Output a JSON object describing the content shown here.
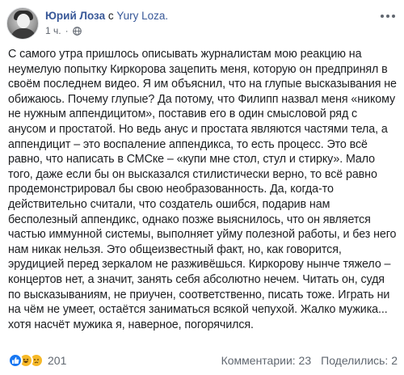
{
  "header": {
    "author_name": "Юрий Лоза",
    "with_word": "с",
    "page_name": "Yury Loza.",
    "time": "1 ч.",
    "dot": "·"
  },
  "post": {
    "text": "С самого утра пришлось описывать журналистам мою реакцию на неумелую попытку Киркорова зацепить меня, которую он предпринял в своём последнем видео. Я им объяснил, что на глупые высказывания не обижаюсь. Почему глупые? Да потому, что Филипп назвал меня «никому не нужным аппендицитом», поставив его в один смысловой ряд с анусом и простатой. Но ведь анус и простата являются частями тела, а аппендицит – это воспаление аппендикса, то есть процесс. Это всё равно, что написать в СМСке – «купи мне стол, стул и стирку». Мало того, даже если бы он высказался стилистически верно, то всё равно продемонстрировал бы свою необразованность. Да, когда-то действительно считали, что создатель ошибся, подарив нам бесполезный аппендикс, однако позже выяснилось, что он является частью иммунной системы, выполняет уйму полезной работы, и без него нам никак нельзя. Это общеизвестный факт, но, как говорится, эрудицией перед зеркалом не разживёшься. Киркорову нынче тяжело – концертов нет, а значит, занять себя абсолютно нечем. Читать он, судя по высказываниям, не приучен, соответственно, писать тоже. Играть ни на чём не умеет, остаётся заниматься всякой чепухой. Жалко мужика... хотя насчёт мужика я, наверное, погорячился."
  },
  "footer": {
    "reaction_count": "201",
    "comments": "Комментарии: 23",
    "shares": "Поделились: 2"
  },
  "icons": {
    "reactions": [
      "like-icon",
      "haha-icon",
      "sad-icon"
    ],
    "visibility": "globe-icon",
    "menu": "more-icon"
  },
  "colors": {
    "link": "#385898",
    "text": "#1c1e21",
    "muted": "#606770",
    "like": "#1877f2",
    "emoji": "#f7b928"
  }
}
